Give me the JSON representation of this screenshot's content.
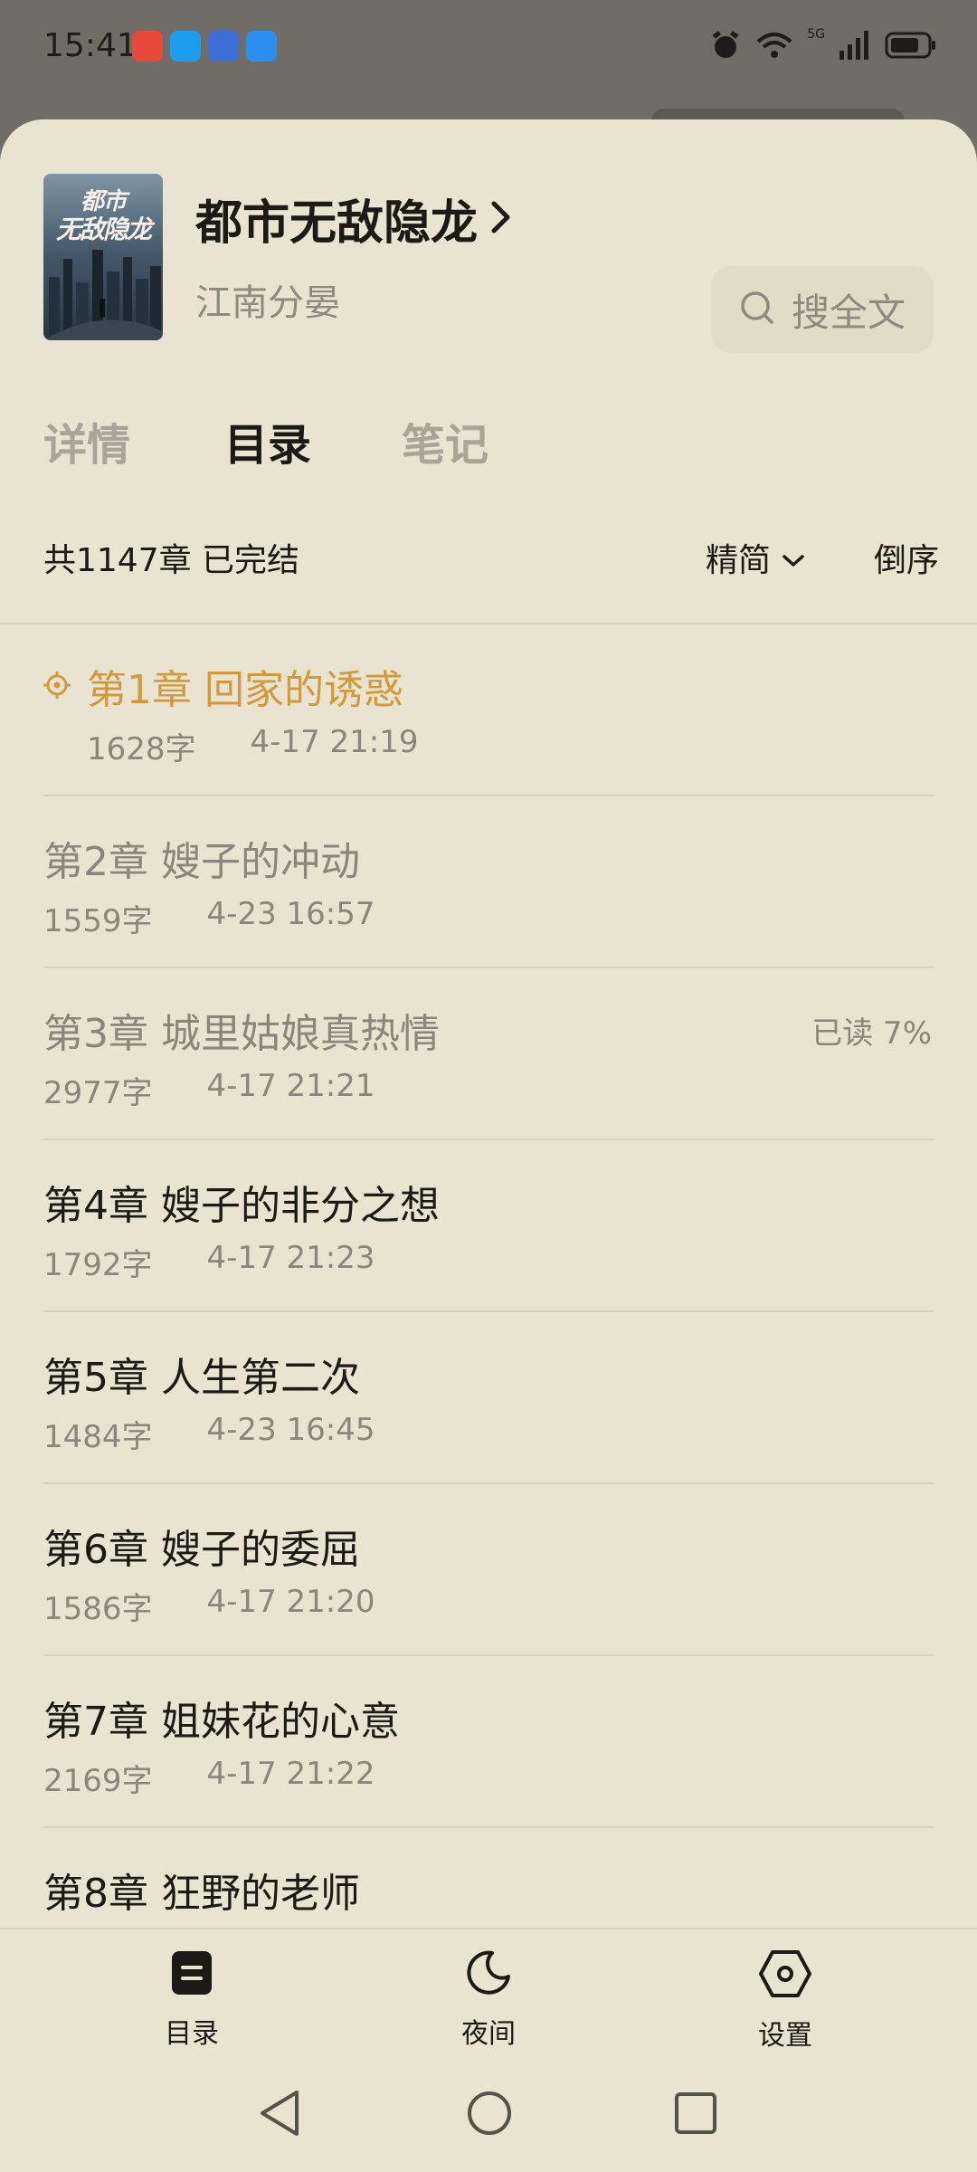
{
  "status_bar": {
    "time": "15:41",
    "app_icon_colors": [
      "#e8493a",
      "#1b9df0",
      "#3d6fd6",
      "#2b8ff2"
    ],
    "network_label": "5G"
  },
  "book": {
    "title": "都市无敌隐龙",
    "author": "江南分晏",
    "cover_line1": "都市",
    "cover_line2": "无敌隐龙"
  },
  "search": {
    "label": "搜全文"
  },
  "tabs": [
    {
      "label": "详情",
      "active": false
    },
    {
      "label": "目录",
      "active": true
    },
    {
      "label": "笔记",
      "active": false
    }
  ],
  "summary": {
    "text": "共1147章 已完结",
    "filter_label": "精简",
    "order_label": "倒序"
  },
  "chapters": [
    {
      "title": "第1章 回家的诱惑",
      "words": "1628字",
      "date": "4-17 21:19",
      "state": "current",
      "progress": ""
    },
    {
      "title": "第2章 嫂子的冲动",
      "words": "1559字",
      "date": "4-23 16:57",
      "state": "read",
      "progress": ""
    },
    {
      "title": "第3章 城里姑娘真热情",
      "words": "2977字",
      "date": "4-17 21:21",
      "state": "read",
      "progress": "已读 7%"
    },
    {
      "title": "第4章 嫂子的非分之想",
      "words": "1792字",
      "date": "4-17 21:23",
      "state": "unread",
      "progress": ""
    },
    {
      "title": "第5章 人生第二次",
      "words": "1484字",
      "date": "4-23 16:45",
      "state": "unread",
      "progress": ""
    },
    {
      "title": "第6章 嫂子的委屈",
      "words": "1586字",
      "date": "4-17 21:20",
      "state": "unread",
      "progress": ""
    },
    {
      "title": "第7章 姐妹花的心意",
      "words": "2169字",
      "date": "4-17 21:22",
      "state": "unread",
      "progress": ""
    },
    {
      "title": "第8章 狂野的老师",
      "words": "",
      "date": "",
      "state": "unread",
      "progress": ""
    }
  ],
  "bottom_nav": [
    {
      "label": "目录",
      "icon": "toc-icon"
    },
    {
      "label": "夜间",
      "icon": "moon-icon"
    },
    {
      "label": "设置",
      "icon": "settings-hexagon-icon"
    }
  ],
  "colors": {
    "background": "#e9e3d1",
    "accent": "#d19b3d",
    "text_primary": "#1d1a15",
    "text_secondary": "#8a867c"
  }
}
